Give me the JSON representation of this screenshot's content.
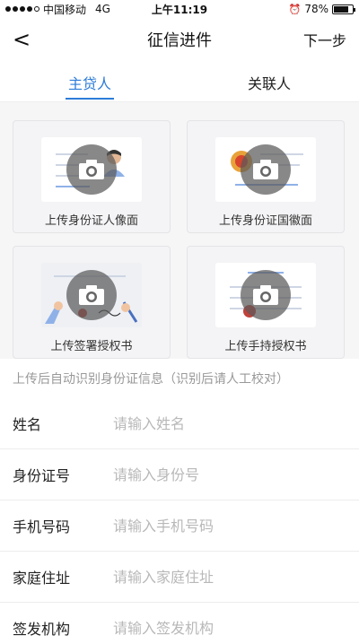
{
  "status_bar": {
    "carrier": "中国移动",
    "network": "4G",
    "time": "上午11:19",
    "battery_text": "78%",
    "battery_level": 0.78
  },
  "nav": {
    "back_icon": "chevron-left-icon",
    "back_glyph": "<",
    "title": "征信进件",
    "next_label": "下一步"
  },
  "tabs": [
    {
      "label": "主贷人",
      "active": true
    },
    {
      "label": "关联人",
      "active": false
    }
  ],
  "uploads": [
    {
      "label": "上传身份证人像面",
      "icon": "camera-icon"
    },
    {
      "label": "上传身份证国徽面",
      "icon": "camera-icon"
    },
    {
      "label": "上传签署授权书",
      "icon": "camera-icon"
    },
    {
      "label": "上传手持授权书",
      "icon": "camera-icon"
    }
  ],
  "hint": "上传后自动识别身份证信息（识别后请人工校对）",
  "form": {
    "name": {
      "label": "姓名",
      "placeholder": "请输入姓名"
    },
    "id_number": {
      "label": "身份证号",
      "placeholder": "请输入身份号"
    },
    "phone": {
      "label": "手机号码",
      "placeholder": "请输入手机号码"
    },
    "address": {
      "label": "家庭住址",
      "placeholder": "请输入家庭住址"
    },
    "issuer": {
      "label": "签发机构",
      "placeholder": "请输入签发机构"
    }
  },
  "colors": {
    "accent": "#2d7bd8",
    "placeholder": "#b8b8b8"
  }
}
